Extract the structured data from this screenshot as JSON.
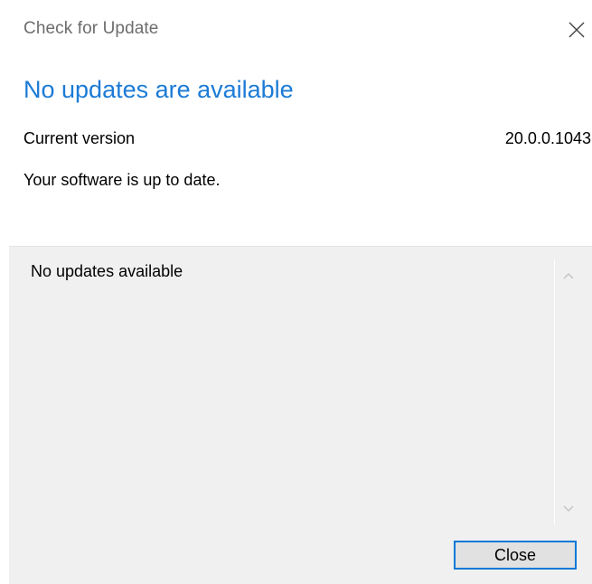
{
  "window": {
    "title": "Check for Update"
  },
  "main": {
    "heading": "No updates are available",
    "version_label": "Current version",
    "version_value": "20.0.0.1043",
    "status": "Your software is up to date."
  },
  "notes": {
    "text": "No updates available"
  },
  "footer": {
    "close_label": "Close"
  },
  "icons": {
    "close": "close-icon",
    "scroll_up": "chevron-up-icon",
    "scroll_down": "chevron-down-icon"
  },
  "colors": {
    "heading": "#1c7bd6",
    "title": "#6d6d6d",
    "panel_background": "#f0f0f0",
    "button_border": "#0078d7",
    "button_background": "#e1e1e1"
  }
}
